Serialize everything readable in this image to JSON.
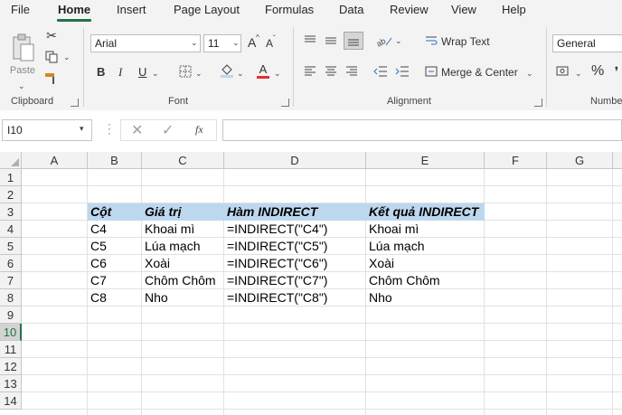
{
  "menu": [
    "File",
    "Home",
    "Insert",
    "Page Layout",
    "Formulas",
    "Data",
    "Review",
    "View",
    "Help"
  ],
  "ribbon": {
    "clipboard": {
      "paste": "Paste",
      "label": "Clipboard"
    },
    "font": {
      "name": "Arial",
      "size": "11",
      "grow": "A",
      "shrink": "A",
      "bold": "B",
      "italic": "I",
      "underline": "U",
      "color_letter": "A",
      "label": "Font"
    },
    "alignment": {
      "wrap": "Wrap Text",
      "merge": "Merge & Center",
      "label": "Alignment"
    },
    "number": {
      "format": "General",
      "percent": "%",
      "label": "Numbe"
    }
  },
  "formula_bar": {
    "name_box": "I10",
    "fx": "fx",
    "value": ""
  },
  "columns": [
    "A",
    "B",
    "C",
    "D",
    "E",
    "F",
    "G"
  ],
  "rows": [
    "1",
    "2",
    "3",
    "4",
    "5",
    "6",
    "7",
    "8",
    "9",
    "10",
    "11",
    "12",
    "13",
    "14"
  ],
  "selected_row": "10",
  "table": {
    "headers": [
      "Cột",
      "Giá trị",
      "Hàm INDIRECT",
      "Kết quả INDIRECT"
    ],
    "rows": [
      [
        "C4",
        "Khoai mì",
        "=INDIRECT(\"C4\")",
        "Khoai mì"
      ],
      [
        "C5",
        "Lúa mạch",
        "=INDIRECT(\"C5\")",
        "Lúa mạch"
      ],
      [
        "C6",
        "Xoài",
        "=INDIRECT(\"C6\")",
        "Xoài"
      ],
      [
        "C7",
        "Chôm Chôm",
        "=INDIRECT(\"C7\")",
        "Chôm Chôm"
      ],
      [
        "C8",
        "Nho",
        "=INDIRECT(\"C8\")",
        "Nho"
      ]
    ]
  },
  "colors": {
    "accent": "#217346",
    "header_fill": "#bdd7ee",
    "font_color_bar": "#e03030"
  }
}
